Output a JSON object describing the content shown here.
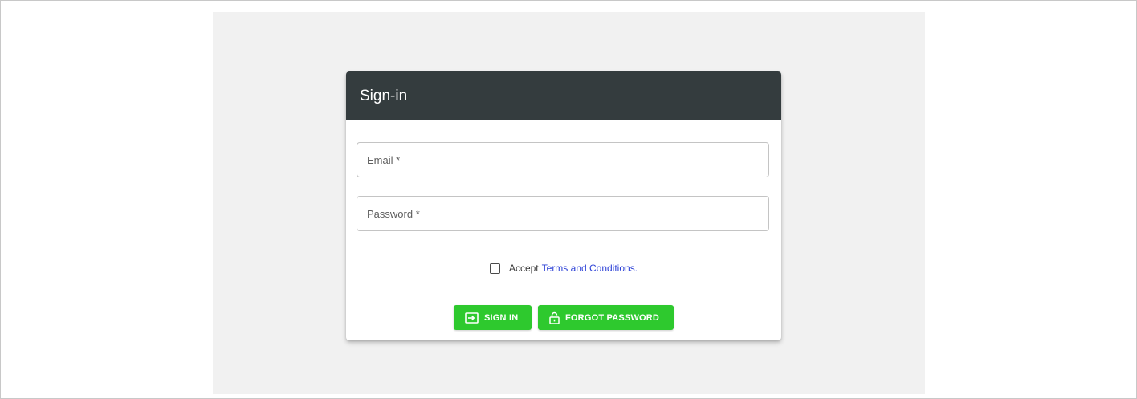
{
  "card": {
    "title": "Sign-in"
  },
  "form": {
    "email_placeholder": "Email *",
    "password_placeholder": "Password *",
    "terms_prefix": "Accept",
    "terms_link": "Terms and Conditions."
  },
  "buttons": {
    "signin_label": "SIGN IN",
    "forgot_label": "FORGOT PASSWORD"
  },
  "icons": {
    "signin": "login-icon",
    "forgot": "lock-open-icon"
  },
  "colors": {
    "header_bg": "#343c3e",
    "button_bg": "#2ec92e",
    "link": "#2a3fd6",
    "panel_bg": "#f1f1f1"
  }
}
